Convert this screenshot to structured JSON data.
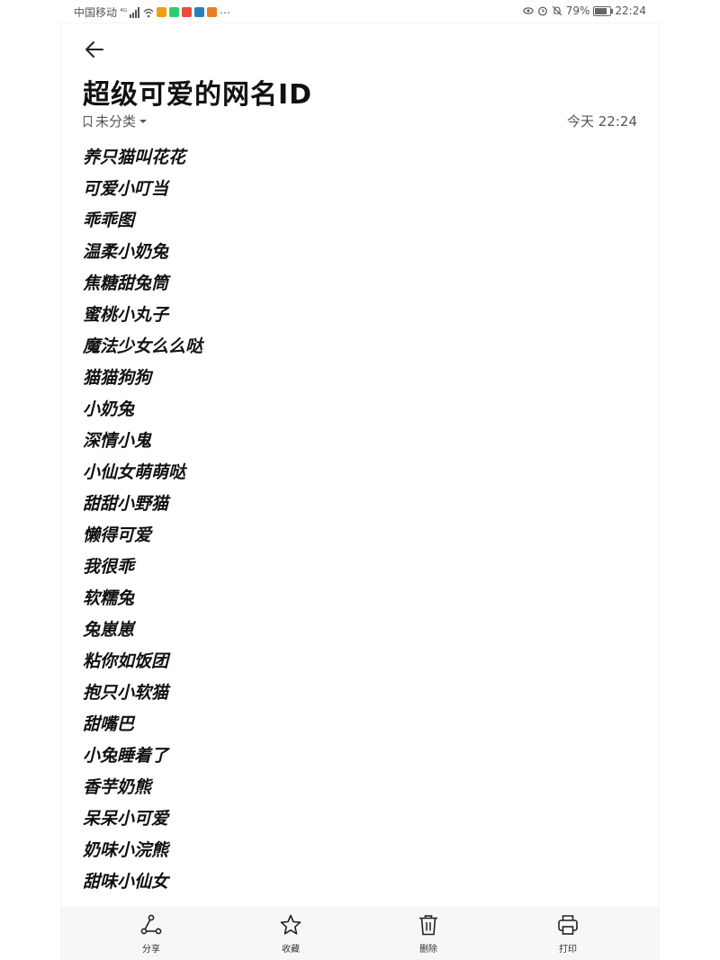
{
  "status_bar": {
    "carrier": "中国移动",
    "network": "⁴ᴳ",
    "battery_text": "79%",
    "battery_level": 0.79,
    "time": "22:24",
    "app_colors": [
      "#f39c12",
      "#2ecc71",
      "#e74c3c",
      "#2980b9",
      "#e67e22"
    ]
  },
  "note": {
    "title": "超级可爱的网名ID",
    "category": "未分类",
    "timestamp": "今天 22:24",
    "items": [
      "养只猫叫花花",
      "可爱小叮当",
      "乖乖图",
      "温柔小奶兔",
      "焦糖甜兔筒",
      "蜜桃小丸子",
      "魔法少女么么哒",
      "猫猫狗狗",
      "小奶兔",
      "深情小鬼",
      "小仙女萌萌哒",
      "甜甜小野猫",
      "懒得可爱",
      "我很乖",
      "软糯兔",
      "兔崽崽",
      "粘你如饭团",
      "抱只小软猫",
      "甜嘴巴",
      "小兔睡着了",
      "香芋奶熊",
      "呆呆小可爱",
      "奶味小浣熊",
      "甜味小仙女"
    ]
  },
  "toolbar": {
    "share_label": "分享",
    "favorite_label": "收藏",
    "delete_label": "删除",
    "print_label": "打印"
  },
  "icons": {
    "back": "arrow-left-icon",
    "category": "bookmark-icon",
    "dropdown": "caret-down-icon",
    "share": "share-icon",
    "favorite": "star-icon",
    "delete": "trash-icon",
    "print": "printer-icon"
  }
}
